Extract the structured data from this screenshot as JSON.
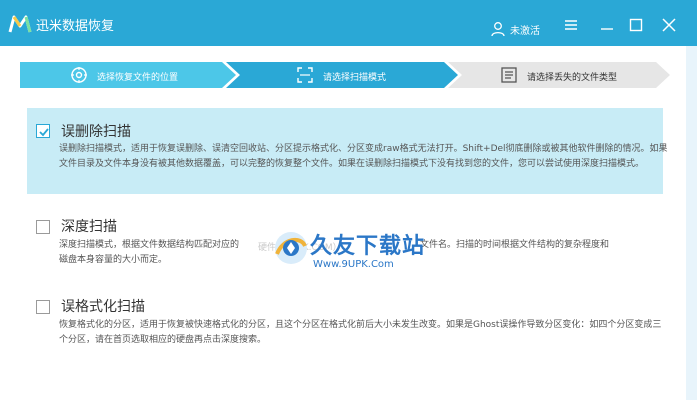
{
  "window": {
    "title": "迅米数据恢复",
    "user_label": "未激活",
    "icons": [
      "logo-icon",
      "user-icon",
      "menu-icon",
      "minimize-icon",
      "maximize-icon",
      "close-icon"
    ]
  },
  "steps": [
    {
      "label": "选择恢复文件的位置",
      "icon": "target-icon",
      "state": "done"
    },
    {
      "label": "请选择扫描模式",
      "icon": "scan-frame-icon",
      "state": "active"
    },
    {
      "label": "请选择丢失的文件类型",
      "icon": "list-icon",
      "state": "pending"
    }
  ],
  "options": [
    {
      "title": "误删除扫描",
      "checked": true,
      "desc": "误删除扫描模式，适用于恢复误删除、误清空回收站、分区提示格式化、分区变成raw格式无法打开。Shift+Del彻底删除或被其他软件删除的情况。如果文件目录及文件本身没有被其他数据覆盖，可以完整的恢复整个文件。如果在误删除扫描模式下没有找到您的文件，您可以尝试使用深度扫描模式。"
    },
    {
      "title": "深度扫描",
      "checked": false,
      "desc_a": "深度扫描模式，根据文件数据结构匹配对应的",
      "desc_b": "文件名。扫描的时间根据文件结构的复杂程度和",
      "desc_c": "磁盘本身容量的大小而定。"
    },
    {
      "title": "误格式化扫描",
      "checked": false,
      "desc": "恢复格式化的分区，适用于恢复被快速格式化的分区，且这个分区在格式化前后大小未发生改变。如果是Ghost误操作导致分区变化：如四个分区变成三个分区，请在首页选取相应的硬盘再点击深度搜索。"
    }
  ],
  "watermark": {
    "title": "久友下载站",
    "url": "Www.9UPK.Com",
    "faint": "硬件（9UPK.COM）"
  },
  "colors": {
    "titlebar": "#2aa8d6",
    "step_done": "#4cc7e8",
    "step_active": "#2aa8d6",
    "step_pending": "#e6e6e6",
    "selected_bg": "#c8ecf6",
    "watermark": "#2b77c7"
  }
}
